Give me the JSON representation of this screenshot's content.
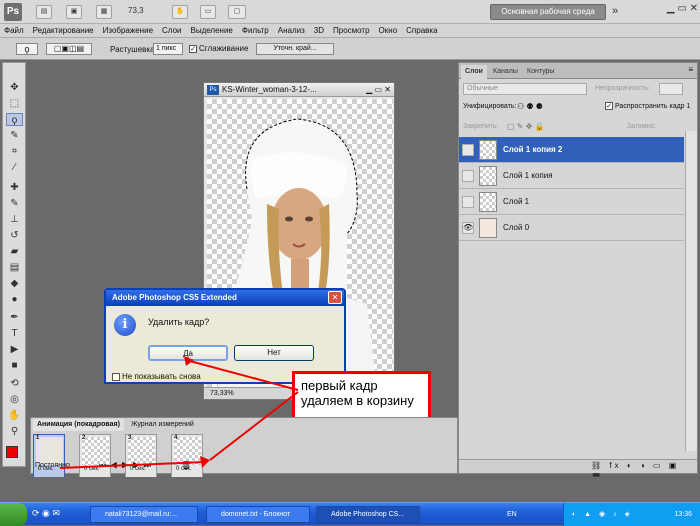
{
  "appbar": {
    "logo": "Ps",
    "zoom": "73,3",
    "workspace_label": "Основная рабочая среда",
    "more": "»"
  },
  "menu": [
    "Файл",
    "Редактирование",
    "Изображение",
    "Слои",
    "Выделение",
    "Фильтр",
    "Анализ",
    "3D",
    "Просмотр",
    "Окно",
    "Справка"
  ],
  "options": {
    "feather_label": "Растушевка:",
    "feather_value": "1 пикс",
    "antialias_label": "Сглаживание",
    "refine_edge": "Уточн. край..."
  },
  "document": {
    "title": "KS-Winter_woman-3-12-...",
    "zoom_status": "73,33%"
  },
  "dialog": {
    "title": "Adobe Photoshop CS5 Extended",
    "icon": "i",
    "question": "Удалить кадр?",
    "yes": "Да",
    "no": "Нет",
    "dont_show": "Не показывать снова"
  },
  "annotation": "первый кадр удаляем в корзину",
  "layers_panel": {
    "tabs": [
      "Слои",
      "Каналы",
      "Контуры"
    ],
    "blend_mode": "Обычные",
    "opacity_label": "Непрозрачность:",
    "unify_label": "Унифицировать:",
    "propagate_label": "Распространить кадр 1",
    "lock_label": "Закрепить:",
    "fill_label": "Заливка:",
    "layers": [
      {
        "name": "Слой 1 копия 2",
        "selected": true,
        "visible": false
      },
      {
        "name": "Слой 1 копия",
        "selected": false,
        "visible": false
      },
      {
        "name": "Слой 1",
        "selected": false,
        "visible": false
      },
      {
        "name": "Слой 0",
        "selected": false,
        "visible": true
      }
    ]
  },
  "animation": {
    "tabs": [
      "Анимация (покадровая)",
      "Журнал измерений"
    ],
    "frames": [
      {
        "num": "1",
        "delay": "0 сек."
      },
      {
        "num": "2",
        "delay": "0 сек."
      },
      {
        "num": "3",
        "delay": "0 сек."
      },
      {
        "num": "4",
        "delay": "0 сек."
      }
    ],
    "loop": "Постоянно"
  },
  "taskbar": {
    "items": [
      "natali73123@mail.ru:...",
      "domonet.txt - Блокнот",
      "Adobe Photoshop CS..."
    ],
    "lang": "EN",
    "clock": "13:36"
  },
  "colors": {
    "accent": "#3160b8",
    "annotation": "#ee0000",
    "dialog_title": "#0a3fb8"
  }
}
